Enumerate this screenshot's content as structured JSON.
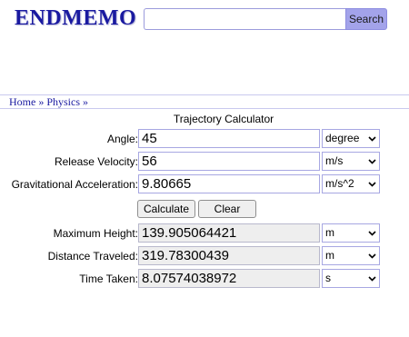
{
  "header": {
    "logo": "ENDMEMO",
    "search_placeholder": "",
    "search_button": "Search"
  },
  "breadcrumb": {
    "home": "Home",
    "sep1": "»",
    "physics": "Physics",
    "sep2": "»"
  },
  "calculator": {
    "title": "Trajectory Calculator",
    "inputs": [
      {
        "label": "Angle:",
        "value": "45",
        "unit": "degree"
      },
      {
        "label": "Release Velocity:",
        "value": "56",
        "unit": "m/s"
      },
      {
        "label": "Gravitational Acceleration:",
        "value": "9.80665",
        "unit": "m/s^2"
      }
    ],
    "buttons": {
      "calculate": "Calculate",
      "clear": "Clear"
    },
    "outputs": [
      {
        "label": "Maximum Height:",
        "value": "139.905064421",
        "unit": "m"
      },
      {
        "label": "Distance Traveled:",
        "value": "319.78300439",
        "unit": "m"
      },
      {
        "label": "Time Taken:",
        "value": "8.07574038972",
        "unit": "s"
      }
    ]
  },
  "colors": {
    "brand": "#1a1aa0",
    "search_button": "#a3a3ea",
    "input_border": "#a7a7e2",
    "output_bg": "#eeeeee"
  }
}
